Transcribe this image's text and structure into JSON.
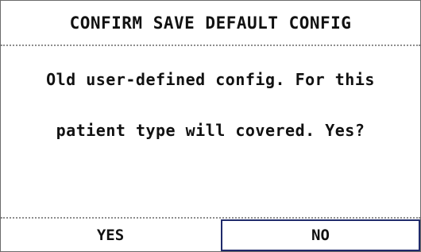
{
  "dialog": {
    "title": "CONFIRM SAVE DEFAULT CONFIG",
    "message_line1": "Old user-defined config. For this",
    "message_line2": "patient type will covered. Yes?"
  },
  "buttons": {
    "yes_label": "YES",
    "no_label": "NO",
    "selected": "NO"
  },
  "colors": {
    "background": "#ffffff",
    "text": "#111111",
    "focus_border": "#1f2a6b",
    "divider": "#8e8e8e"
  }
}
